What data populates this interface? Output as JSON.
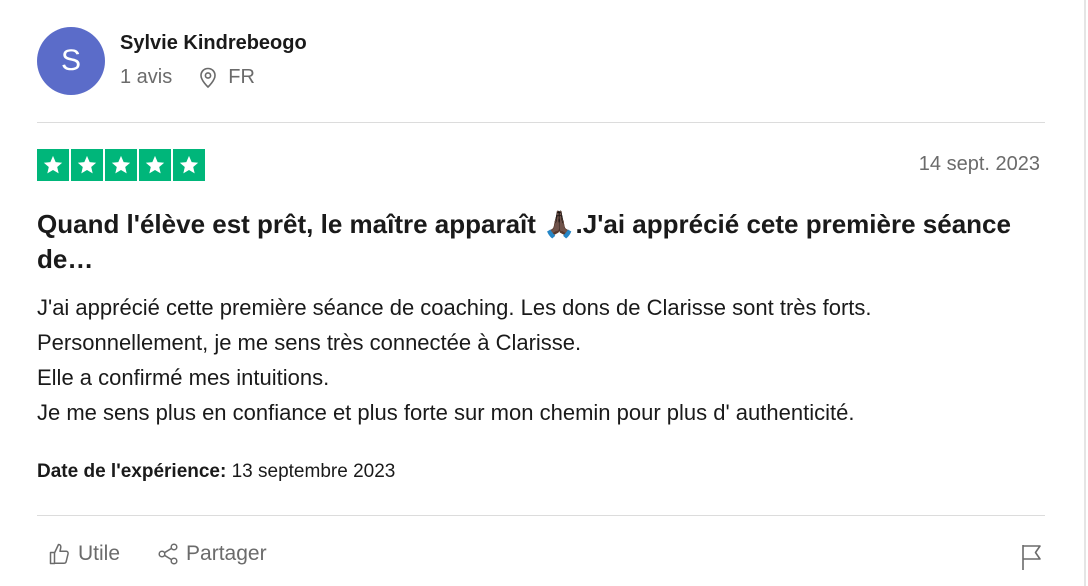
{
  "reviewer": {
    "initial": "S",
    "name": "Sylvie Kindrebeogo",
    "review_count": "1 avis",
    "country": "FR",
    "avatar_color": "#5b6cc9"
  },
  "review": {
    "rating": 5,
    "max_rating": 5,
    "star_color": "#00b67a",
    "date": "14 sept. 2023",
    "title": "Quand l'élève est prêt, le maître apparaît 🙏🏿.J'ai apprécié cete première séance de…",
    "body": [
      "J'ai apprécié cette première séance de coaching. Les dons de Clarisse sont très forts.",
      "Personnellement, je me sens très connectée à Clarisse.",
      "Elle a confirmé mes intuitions.",
      "Je me sens plus en confiance et plus forte sur mon chemin pour plus d' authenticité."
    ],
    "experience_label": "Date de l'expérience:",
    "experience_date": " 13 septembre 2023"
  },
  "actions": {
    "useful_label": "Utile",
    "useful_icon": "thumbs-up-icon",
    "share_label": "Partager",
    "share_icon": "share-icon",
    "report_icon": "flag-icon"
  }
}
